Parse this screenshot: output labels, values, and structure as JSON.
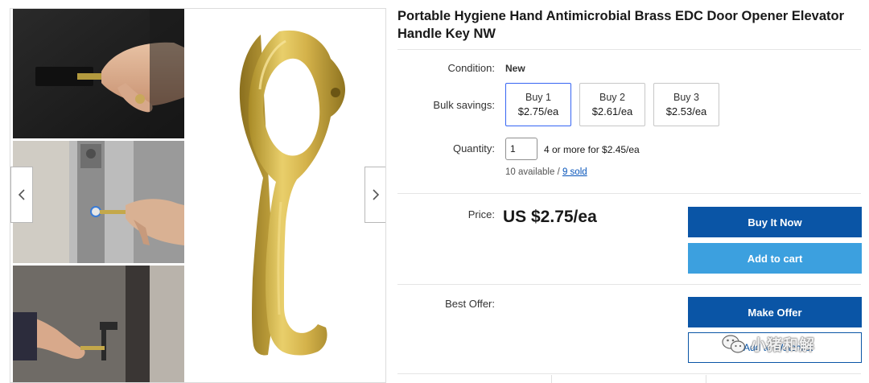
{
  "listing": {
    "title": "Portable Hygiene Hand Antimicrobial Brass EDC Door Opener Elevator Handle Key NW"
  },
  "gallery": {
    "prev_icon": "chevron-left-icon",
    "next_icon": "chevron-right-icon",
    "thumbnails": [
      "hand-holding-key-photo",
      "elevator-button-photo",
      "door-handle-photo"
    ],
    "main_image": "brass-door-opener-product-image"
  },
  "condition": {
    "label": "Condition:",
    "value": "New"
  },
  "bulk": {
    "label": "Bulk savings:",
    "options": [
      {
        "qty": "Buy 1",
        "price": "$2.75/ea",
        "selected": true
      },
      {
        "qty": "Buy 2",
        "price": "$2.61/ea",
        "selected": false
      },
      {
        "qty": "Buy 3",
        "price": "$2.53/ea",
        "selected": false
      }
    ]
  },
  "quantity": {
    "label": "Quantity:",
    "value": "1",
    "note": "4 or more for $2.45/ea",
    "available": "10 available / ",
    "sold": "9 sold"
  },
  "price": {
    "label": "Price:",
    "value": "US $2.75/ea"
  },
  "buttons": {
    "buy_now": "Buy It Now",
    "add_to_cart": "Add to cart",
    "make_offer": "Make Offer",
    "watchlist": "Add to Watchlist"
  },
  "best_offer": {
    "label": "Best Offer:"
  },
  "watermark": {
    "icon": "wechat-icon",
    "text": "小猪和解"
  },
  "colors": {
    "primary_button": "#0a55a6",
    "secondary_button": "#3ca0df",
    "selected_border": "#3665f3",
    "link": "#0654ba",
    "brass": "#d4b24a"
  }
}
